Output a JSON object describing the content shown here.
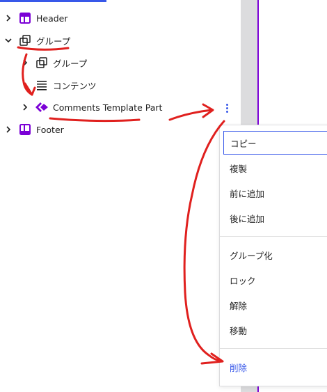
{
  "tree": {
    "items": [
      {
        "label": "Header",
        "icon": "template-part-icon",
        "expanded": false
      },
      {
        "label": "グループ",
        "icon": "group-icon",
        "expanded": true
      },
      {
        "label": "グループ",
        "icon": "group-icon",
        "expanded": false
      },
      {
        "label": "コンテンツ",
        "icon": "content-lines-icon",
        "expanded": null
      },
      {
        "label": "Comments Template Part",
        "icon": "diamond-icon",
        "expanded": false
      },
      {
        "label": "Footer",
        "icon": "template-part-icon",
        "expanded": false
      }
    ]
  },
  "menu": {
    "copy": "コピー",
    "duplicate": "複製",
    "insert_before": "前に追加",
    "insert_after": "後に追加",
    "group": "グループ化",
    "lock": "ロック",
    "ungroup": "解除",
    "move": "移動",
    "delete": "削除"
  },
  "colors": {
    "accent_blue": "#3858e9",
    "purple": "#7b00d6",
    "annotation_red": "#e0201e",
    "gutter_gray": "#dcdcde"
  }
}
